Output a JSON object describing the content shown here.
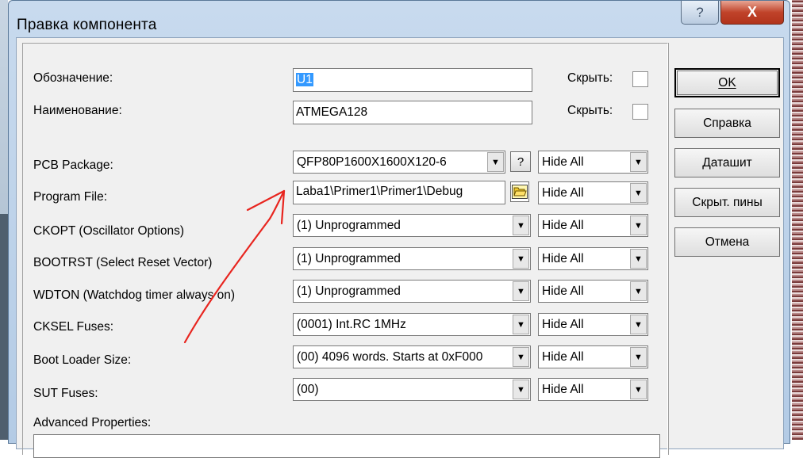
{
  "window": {
    "title": "Правка компонента",
    "help_glyph": "?",
    "close_glyph": "X"
  },
  "fields": {
    "designation": {
      "label": "Обозначение:",
      "value": "U1",
      "hide_label": "Скрыть:"
    },
    "name": {
      "label": "Наименование:",
      "value": "ATMEGA128",
      "hide_label": "Скрыть:"
    }
  },
  "properties": [
    {
      "label": "PCB Package:",
      "value": "QFP80P1600X1600X120-6",
      "visibility": "Hide All",
      "extra": "help"
    },
    {
      "label": "Program File:",
      "value": "Laba1\\Primer1\\Primer1\\Debug",
      "visibility": "Hide All",
      "extra": "folder"
    },
    {
      "label": "CKOPT (Oscillator Options)",
      "value": "(1) Unprogrammed",
      "visibility": "Hide All"
    },
    {
      "label": "BOOTRST (Select Reset Vector)",
      "value": "(1) Unprogrammed",
      "visibility": "Hide All"
    },
    {
      "label": "WDTON (Watchdog timer always on)",
      "value": "(1) Unprogrammed",
      "visibility": "Hide All"
    },
    {
      "label": "CKSEL Fuses:",
      "value": "(0001) Int.RC 1MHz",
      "visibility": "Hide All"
    },
    {
      "label": "Boot Loader Size:",
      "value": "(00) 4096 words. Starts at 0xF000",
      "visibility": "Hide All"
    },
    {
      "label": "SUT Fuses:",
      "value": "(00)",
      "visibility": "Hide All"
    }
  ],
  "advanced_label": "Advanced Properties:",
  "buttons": {
    "ok": "OK",
    "help": "Справка",
    "datasheet": "Даташит",
    "hidden_pins": "Скрыт. пины",
    "cancel": "Отмена"
  },
  "icons": {
    "combo_arrow": "▼",
    "help_button": "?",
    "folder": "folder-open-icon"
  },
  "colors": {
    "selection": "#3399ff",
    "annotation": "#e8251f"
  }
}
